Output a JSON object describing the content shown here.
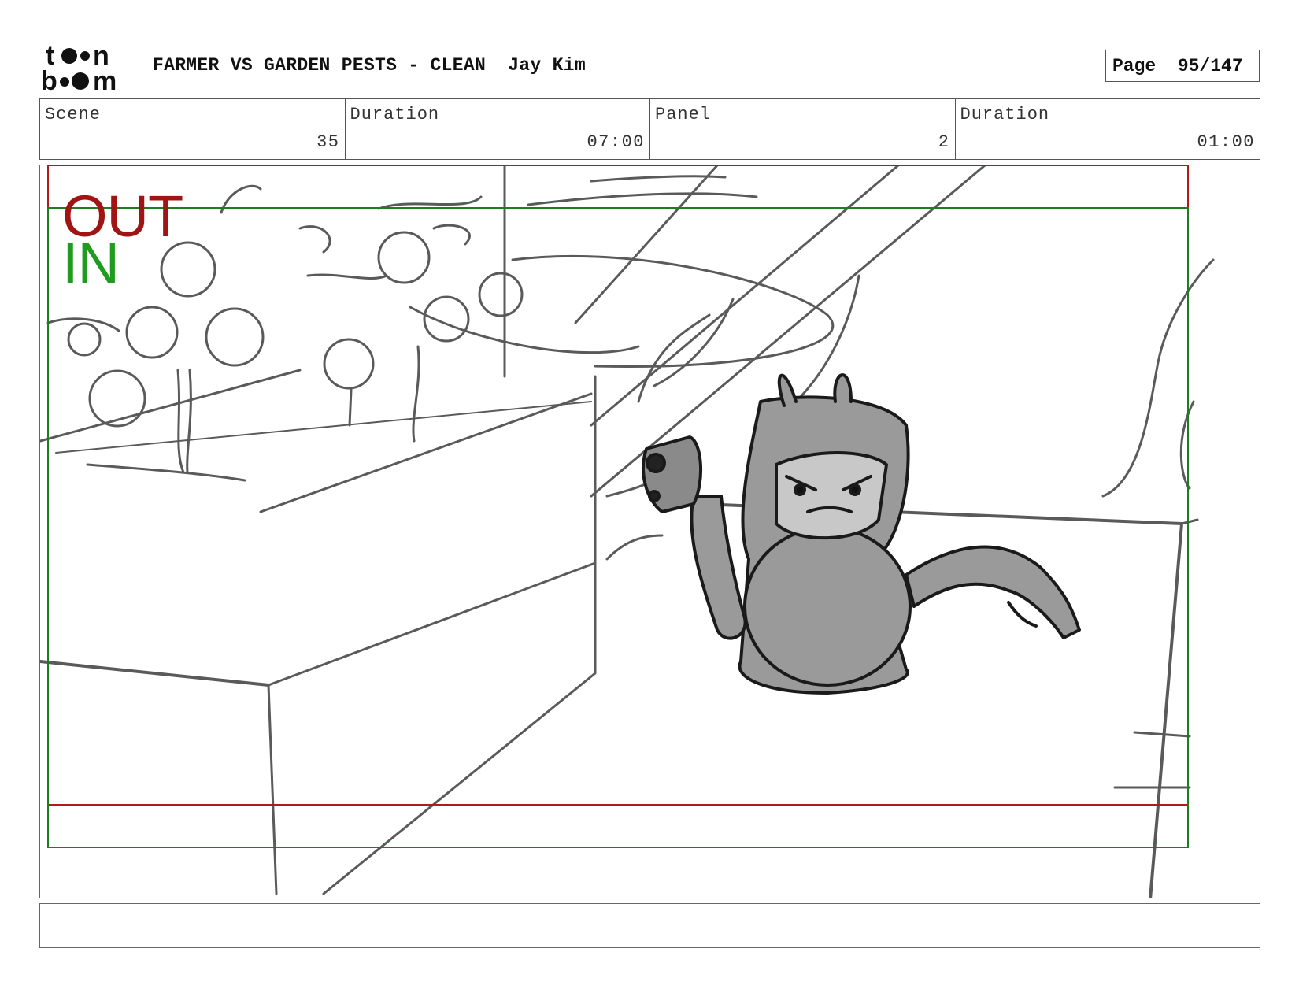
{
  "header": {
    "logo": {
      "line1": "toon",
      "line2": "boom",
      "icon": "toon-boom-logo"
    },
    "title": "FARMER VS GARDEN PESTS - CLEAN  Jay Kim",
    "page_label": "Page",
    "page_value": "95/147"
  },
  "info": {
    "scene_label": "Scene",
    "scene_value": "35",
    "scene_duration_label": "Duration",
    "scene_duration_value": "07:00",
    "panel_label": "Panel",
    "panel_value": "2",
    "panel_duration_label": "Duration",
    "panel_duration_value": "01:00"
  },
  "panel": {
    "out_label": "OUT",
    "in_label": "IN",
    "colors": {
      "out_frame": "#b31b1b",
      "in_frame": "#1e7d1e",
      "sketch": "#555555",
      "character_fill": "#9a9a9a"
    }
  },
  "notes": {
    "text": ""
  }
}
